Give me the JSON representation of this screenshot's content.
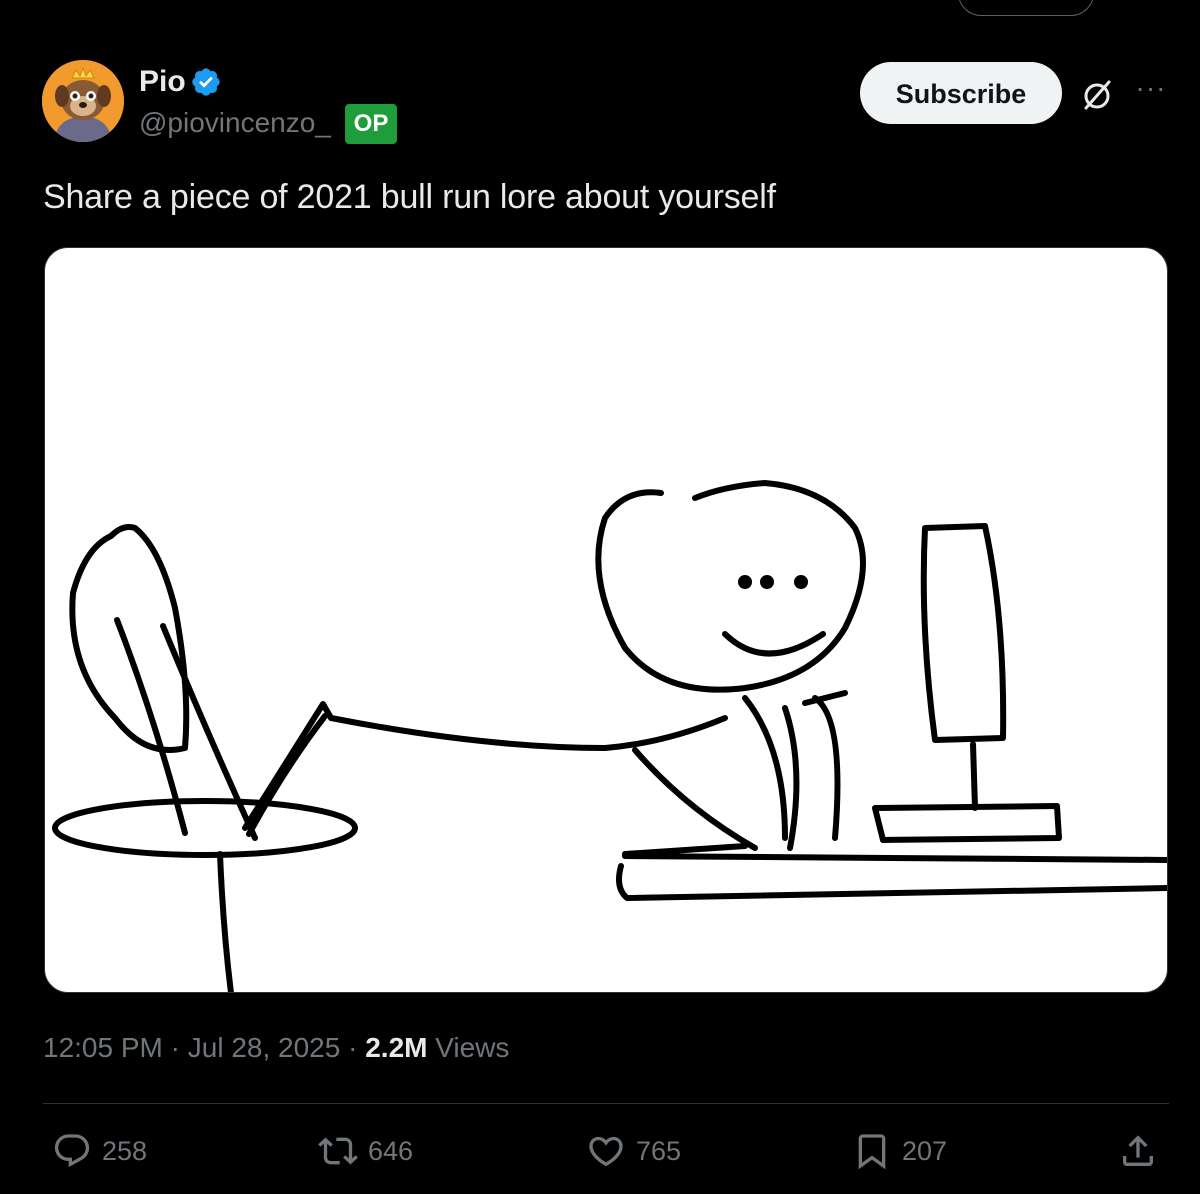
{
  "tweet": {
    "author_name": "Pio",
    "handle": "@piovincenzo_",
    "op_badge": "OP",
    "subscribe_label": "Subscribe",
    "more_label": "···",
    "text": "Share a piece of 2021 bull run lore about yourself",
    "time": "12:05 PM",
    "separator": "·",
    "date": "Jul 28, 2025",
    "views_count": "2.2M",
    "views_label": "Views"
  },
  "actions": {
    "replies": "258",
    "reposts": "646",
    "likes": "765",
    "bookmarks": "207"
  },
  "icons": {
    "verified": "verified-badge-icon",
    "grok": "grok-icon",
    "more": "more-icon",
    "reply": "reply-icon",
    "repost": "repost-icon",
    "like": "heart-icon",
    "bookmark": "bookmark-icon",
    "share": "share-icon"
  },
  "colors": {
    "background": "#000000",
    "primary_text": "#e7e9ea",
    "secondary_text": "#71767b",
    "verified_blue": "#1d9bf0",
    "op_badge_green": "#1f9d3b",
    "subscribe_bg": "#eff3f4",
    "divider": "#2f3336"
  }
}
